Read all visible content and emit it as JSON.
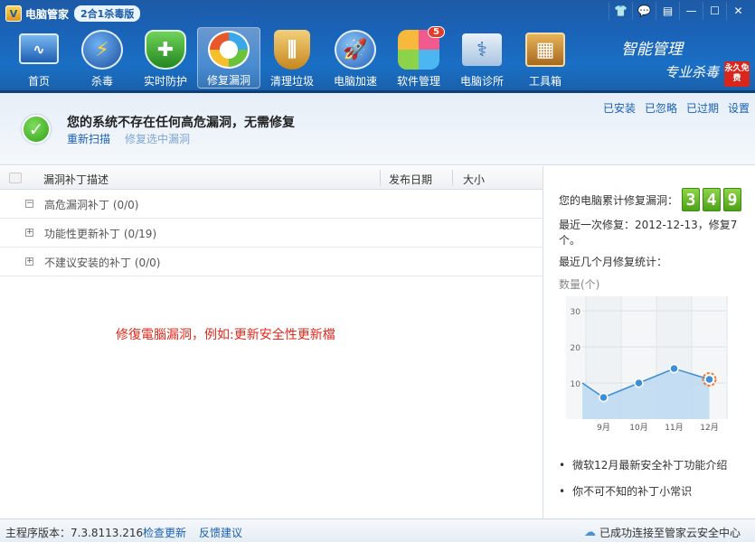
{
  "app": {
    "name": "电脑管家",
    "edition": "2合1杀毒版"
  },
  "window_controls": [
    "shirt-icon",
    "chat-icon",
    "menu-icon",
    "minimize-icon",
    "maximize-icon",
    "close-icon"
  ],
  "toolbar": {
    "items": [
      {
        "label": "首页",
        "icon": "monitor-icon",
        "color": "#2a6ab8"
      },
      {
        "label": "杀毒",
        "icon": "lightning-icon",
        "color": "#1c5fb0"
      },
      {
        "label": "实时防护",
        "icon": "shield-icon",
        "color": "#2c9a3b"
      },
      {
        "label": "修复漏洞",
        "icon": "repair-icon",
        "color": "#e8582a"
      },
      {
        "label": "清理垃圾",
        "icon": "broom-icon",
        "color": "#d79a2b"
      },
      {
        "label": "电脑加速",
        "icon": "rocket-icon",
        "color": "#3a7bd5"
      },
      {
        "label": "软件管理",
        "icon": "apps-icon",
        "color": "#c94ab3",
        "badge": "5"
      },
      {
        "label": "电脑诊所",
        "icon": "stethoscope-icon",
        "color": "#4b7fb0"
      },
      {
        "label": "工具箱",
        "icon": "toolbox-icon",
        "color": "#c78a2a"
      }
    ],
    "active_index": 3
  },
  "slogan": {
    "line1": "智能管理",
    "line2": "专业杀毒",
    "stamp": "永久免费"
  },
  "banner": {
    "message": "您的系统不存在任何高危漏洞，无需修复",
    "rescan": "重新扫描",
    "fix_selected": "修复选中漏洞",
    "right_links": [
      "已安装",
      "已忽略",
      "已过期",
      "设置"
    ]
  },
  "table": {
    "columns": [
      "漏洞补丁描述",
      "发布日期",
      "大小"
    ],
    "groups": [
      {
        "toggle": "−",
        "label": "高危漏洞补丁 (0/0)"
      },
      {
        "toggle": "+",
        "label": "功能性更新补丁 (0/19)"
      },
      {
        "toggle": "+",
        "label": "不建议安装的补丁 (0/0)"
      }
    ]
  },
  "note": "修復電腦漏洞，例如:更新安全性更新檔",
  "side": {
    "cumulative_label": "您的电脑累计修复漏洞：",
    "cumulative_digits": [
      "3",
      "4",
      "9"
    ],
    "last_fix": "最近一次修复：2012-12-13，修复7个。",
    "stats_title": "最近几个月修复统计：",
    "links": [
      "微软12月最新安全补丁功能介绍",
      "你不可不知的补丁小常识"
    ]
  },
  "chart_data": {
    "type": "area",
    "ylabel": "数量(个)",
    "categories": [
      "9月",
      "10月",
      "11月",
      "12月"
    ],
    "values": [
      6,
      10,
      14,
      11
    ],
    "yticks": [
      10,
      20,
      30
    ],
    "ylim": [
      0,
      34
    ],
    "grid": true,
    "highlight_index": 3,
    "fill_color": "#bcd9f1",
    "line_color": "#3d8ed4"
  },
  "footer": {
    "version": "主程序版本：7.3.8113.216",
    "check_update": "检查更新",
    "feedback": "反馈建议",
    "cloud_status": "已成功连接至管家云安全中心"
  }
}
